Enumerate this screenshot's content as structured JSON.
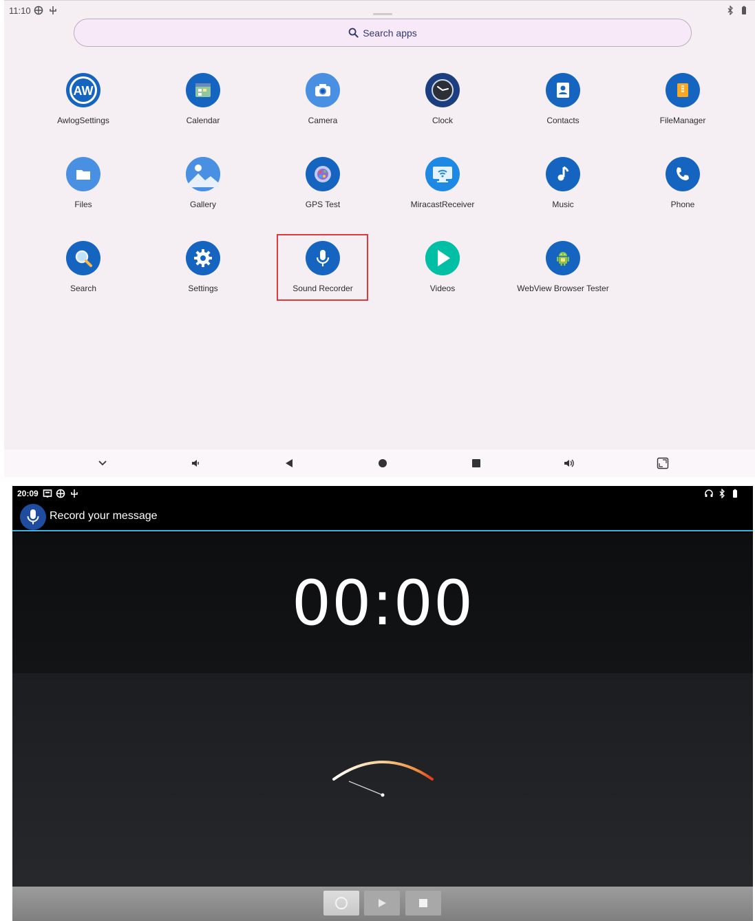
{
  "drawer": {
    "status": {
      "time": "11:10"
    },
    "search": {
      "label": "Search apps",
      "icon": "search-icon"
    },
    "apps": [
      {
        "name": "AwlogSettings",
        "icon": "awlog-icon",
        "color": "#1565c0"
      },
      {
        "name": "Calendar",
        "icon": "calendar-icon",
        "color": "#1565c0"
      },
      {
        "name": "Camera",
        "icon": "camera-icon",
        "color": "#4a90e2"
      },
      {
        "name": "Clock",
        "icon": "clock-icon",
        "color": "#1a3e80"
      },
      {
        "name": "Contacts",
        "icon": "contacts-icon",
        "color": "#1565c0"
      },
      {
        "name": "FileManager",
        "icon": "file-manager-icon",
        "color": "#1565c0"
      },
      {
        "name": "Files",
        "icon": "files-icon",
        "color": "#4a90e2"
      },
      {
        "name": "Gallery",
        "icon": "gallery-icon",
        "color": "#4a90e2"
      },
      {
        "name": "GPS Test",
        "icon": "gps-test-icon",
        "color": "#1565c0"
      },
      {
        "name": "MiracastReceiver",
        "icon": "miracast-icon",
        "color": "#1e88e5"
      },
      {
        "name": "Music",
        "icon": "music-icon",
        "color": "#1565c0"
      },
      {
        "name": "Phone",
        "icon": "phone-icon",
        "color": "#1565c0"
      },
      {
        "name": "Search",
        "icon": "search-app-icon",
        "color": "#1565c0"
      },
      {
        "name": "Settings",
        "icon": "settings-icon",
        "color": "#1565c0"
      },
      {
        "name": "Sound Recorder",
        "icon": "microphone-icon",
        "color": "#1565c0"
      },
      {
        "name": "Videos",
        "icon": "videos-icon",
        "color": "#00bfa5"
      },
      {
        "name": "WebView Browser Tester",
        "icon": "android-icon",
        "color": "#1565c0"
      }
    ],
    "highlighted_app": "Sound Recorder",
    "highlight_color": "#e0393d"
  },
  "recorder": {
    "status": {
      "time": "20:09"
    },
    "title": "Record your message",
    "timer": "00:00",
    "accent": "#33b5e5"
  }
}
